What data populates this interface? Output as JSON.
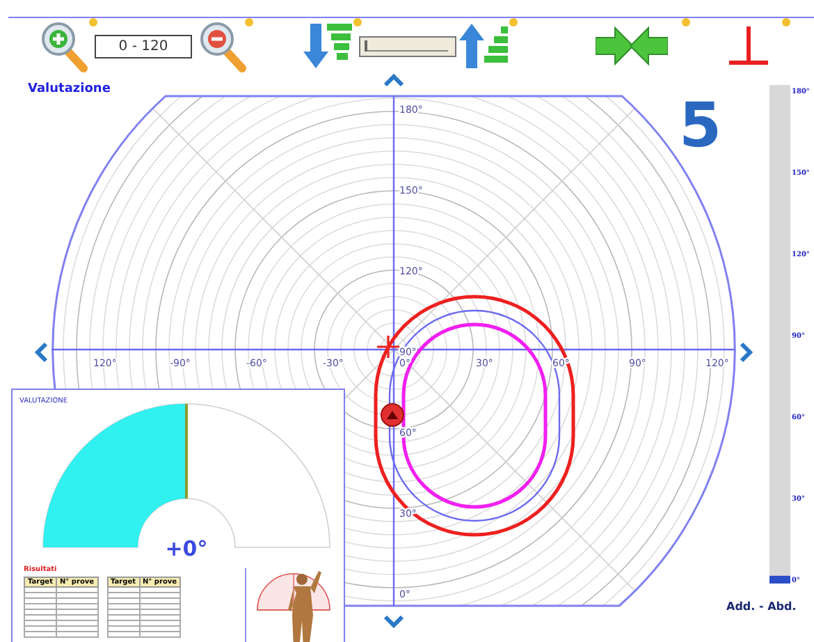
{
  "toolbar": {
    "range": "0 - 120",
    "label": "Valutazione",
    "slider": {
      "level": 0
    }
  },
  "polar_chart": {
    "x_labels": [
      "120°",
      "-90°",
      "-60°",
      "-30°",
      "0°",
      "30°",
      "60°",
      "90°",
      "120°"
    ],
    "y_labels": [
      "180°",
      "150°",
      "120°",
      "90°",
      "60°",
      "30°",
      "0°"
    ]
  },
  "repetition_count": "5",
  "scale": {
    "labels": [
      "180°",
      "150°",
      "120°",
      "90°",
      "60°",
      "30°",
      "0°"
    ],
    "level": 0.01,
    "caption": "Add. - Abd."
  },
  "evaluation": {
    "title": "VALUTAZIONE",
    "level": 0.5,
    "reading": "+0°",
    "results_title": "Risultati",
    "tables": [
      {
        "columns": [
          "Target",
          "N° prove"
        ]
      },
      {
        "columns": [
          "Target",
          "N° prove"
        ]
      }
    ]
  }
}
